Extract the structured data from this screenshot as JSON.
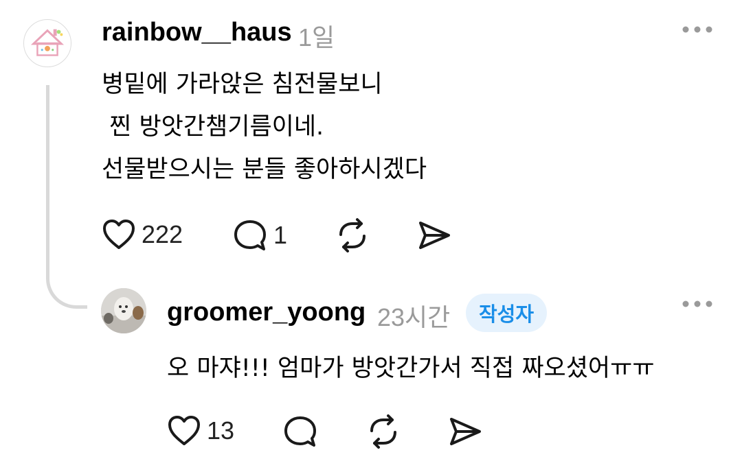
{
  "post": {
    "username": "rainbow__haus",
    "time": "1일",
    "lines": [
      "병밑에 가라앉은 침전물보니",
      " 찐 방앗간챔기름이네.",
      "선물받으시는 분들 좋아하시겠다"
    ],
    "likes": "222",
    "comments": "1",
    "icons": {
      "avatar": "house-logo-avatar",
      "more": "more-options-icon",
      "like": "heart-icon",
      "comment": "comment-bubble-icon",
      "repost": "repost-icon",
      "share": "send-icon"
    }
  },
  "reply": {
    "username": "groomer_yoong",
    "time": "23시간",
    "badge": "작성자",
    "text": "오 마쟈!!! 엄마가 방앗간가서 직접 짜오셨어ㅠㅠ",
    "likes": "13",
    "icons": {
      "avatar": "dog-photo-avatar",
      "more": "more-options-icon",
      "like": "heart-icon",
      "comment": "comment-bubble-icon",
      "repost": "repost-icon",
      "share": "send-icon"
    }
  },
  "colors": {
    "text": "#000000",
    "muted": "#9a9a9a",
    "thread_line": "#d9d9d9",
    "badge_bg": "#e6f2fd",
    "badge_text": "#1a8ee8"
  }
}
